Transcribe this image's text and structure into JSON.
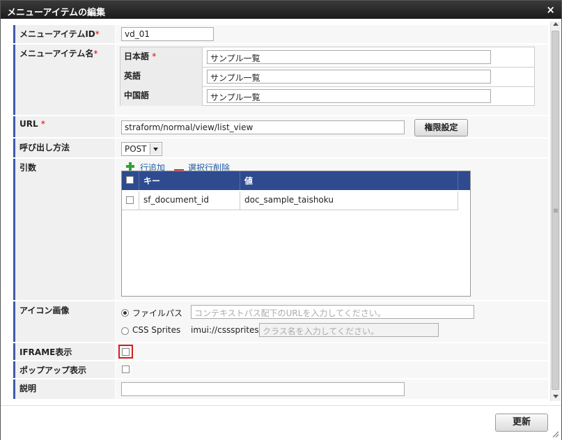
{
  "dialog": {
    "title": "メニューアイテムの編集",
    "close_symbol": "×"
  },
  "required_mark": "*",
  "fields": {
    "menu_item_id": {
      "label": "メニューアイテムID",
      "value": "vd_01"
    },
    "menu_item_name": {
      "label": "メニューアイテム名",
      "languages": [
        {
          "name": "日本語",
          "required": true,
          "value": "サンプル一覧"
        },
        {
          "name": "英語",
          "required": false,
          "value": "サンプル一覧"
        },
        {
          "name": "中国語",
          "required": false,
          "value": "サンプル一覧"
        }
      ]
    },
    "url": {
      "label": "URL",
      "value": "straform/normal/view/list_view",
      "permission_button": "権限設定"
    },
    "call_method": {
      "label": "呼び出し方法",
      "selected": "POST"
    },
    "arguments": {
      "label": "引数",
      "add_row": "行追加",
      "delete_rows": "選択行削除",
      "columns": [
        "キー",
        "値"
      ],
      "rows": [
        {
          "key": "sf_document_id",
          "value": "doc_sample_taishoku"
        }
      ]
    },
    "icon_image": {
      "label": "アイコン画像",
      "file_path_option": "ファイルパス",
      "file_path_placeholder": "コンテキストパス配下のURLを入力してください。",
      "css_sprites_option": "CSS Sprites",
      "css_sprites_prefix": "imui://csssprites/",
      "css_sprites_placeholder": "クラス名を入力してください。",
      "selected": "file_path"
    },
    "iframe_display": {
      "label": "IFRAME表示",
      "checked": false
    },
    "popup_display": {
      "label": "ポップアップ表示",
      "checked": false
    },
    "description": {
      "label": "説明",
      "value": ""
    }
  },
  "footer": {
    "update_button": "更新"
  },
  "colors": {
    "accent": "#3f5aa8",
    "grid_header": "#2e4b8f",
    "required": "#dd0000",
    "highlight_border": "#d0201a"
  }
}
